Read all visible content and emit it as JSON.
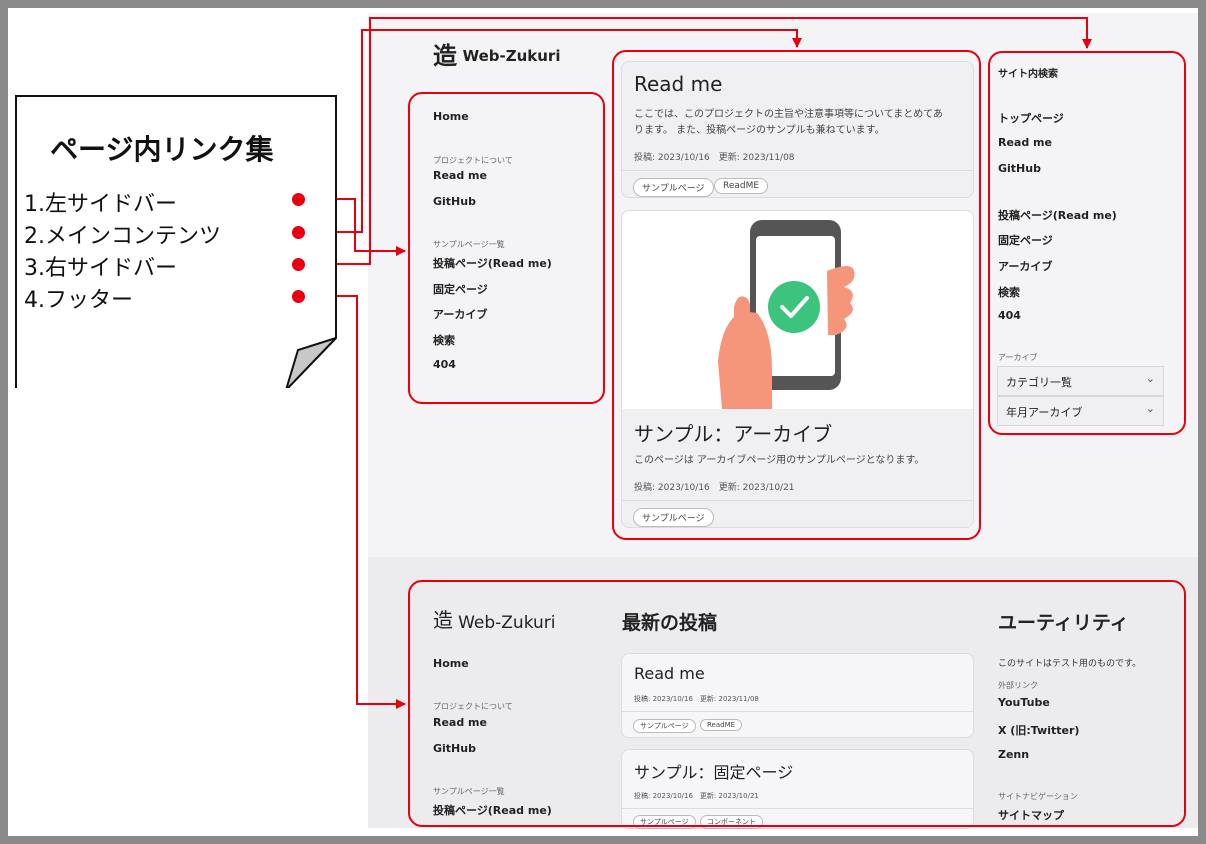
{
  "note": {
    "title": "ページ内リンク集",
    "items": [
      "1.左サイドバー",
      "2.メインコンテンツ",
      "3.右サイドバー",
      "4.フッター"
    ]
  },
  "site": {
    "logo_kanji": "造",
    "logo_text": "Web-Zukuri",
    "left_sidebar": {
      "home": "Home",
      "caption_project": "プロジェクトについて",
      "read_me": "Read me",
      "github": "GitHub",
      "caption_samples": "サンプルページ一覧",
      "sample_items": [
        "投稿ページ(Read me)",
        "固定ページ",
        "アーカイブ",
        "検索",
        "404"
      ]
    },
    "main": {
      "post1": {
        "title": "Read me",
        "excerpt_line1": "ここでは、このプロジェクトの主旨や注意事項等についてまとめてあ",
        "excerpt_line2": "ります。 また、投稿ページのサンプルも兼ねています。",
        "meta": "投稿: 2023/10/16　更新: 2023/11/08",
        "tags": [
          "サンプルページ",
          "ReadME"
        ]
      },
      "post2": {
        "title": "サンプル：アーカイブ",
        "excerpt": "このページは アーカイブページ用のサンプルページとなります。",
        "meta": "投稿: 2023/10/16　更新: 2023/10/21",
        "tags": [
          "サンプルページ"
        ]
      }
    },
    "right_sidebar": {
      "search_label": "サイト内検索",
      "items_a": [
        "トップページ",
        "Read me",
        "GitHub"
      ],
      "items_b": [
        "投稿ページ(Read me)",
        "固定ページ",
        "アーカイブ",
        "検索",
        "404"
      ],
      "archive_caption": "アーカイブ",
      "select_category": "カテゴリ一覧",
      "select_year": "年月アーカイブ"
    },
    "footer": {
      "logo_kanji": "造",
      "logo_text": "Web-Zukuri",
      "home": "Home",
      "caption_project": "プロジェクトについて",
      "read_me": "Read me",
      "github": "GitHub",
      "caption_samples": "サンプルページ一覧",
      "sample_first": "投稿ページ(Read me)",
      "latest_heading": "最新の投稿",
      "latest_post1": {
        "title": "Read me",
        "meta": "投稿: 2023/10/16　更新: 2023/11/08",
        "tags": [
          "サンプルページ",
          "ReadME"
        ]
      },
      "latest_post2": {
        "title": "サンプル：固定ページ",
        "meta": "投稿: 2023/10/16　更新: 2023/10/21",
        "tags": [
          "サンプルページ",
          "コンポーネント"
        ]
      },
      "utility_heading": "ユーティリティ",
      "utility_text": "このサイトはテスト用のものです。",
      "caption_external": "外部リンク",
      "external_links": [
        "YouTube",
        "X (旧:Twitter)",
        "Zenn"
      ],
      "caption_sitenav": "サイトナビゲーション",
      "sitemap": "サイトマップ"
    }
  },
  "colors": {
    "annotation_red": "#e8000e",
    "frame_gray": "#8a8a8a",
    "accent_green": "#3cc47c",
    "hand_skin": "#f5957a"
  }
}
